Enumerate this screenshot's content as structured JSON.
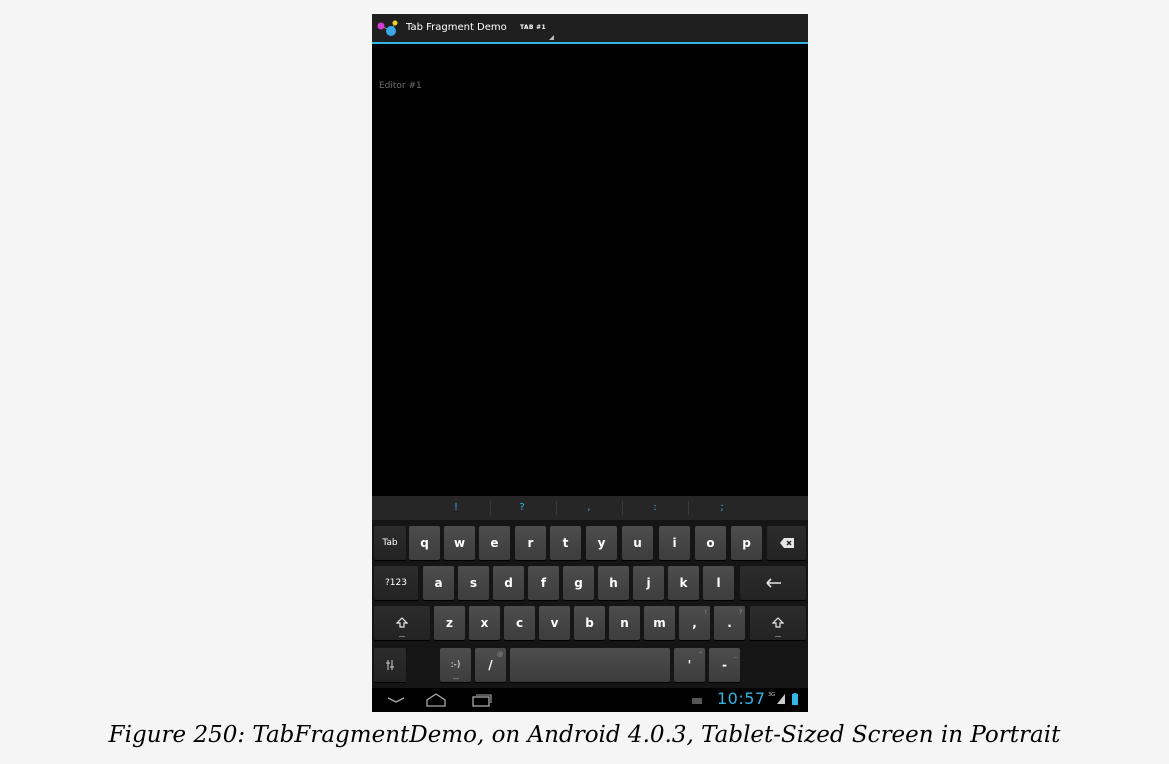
{
  "app": {
    "title": "Tab Fragment Demo",
    "tab_label": "TAB #1"
  },
  "editor": {
    "hint": "Editor #1"
  },
  "keyboard": {
    "suggestions": [
      "!",
      "?",
      ",",
      ":",
      ";"
    ],
    "row1": [
      "Tab",
      "q",
      "w",
      "e",
      "r",
      "t",
      "y",
      "u",
      "i",
      "o",
      "p"
    ],
    "row2": [
      "?123",
      "a",
      "s",
      "d",
      "f",
      "g",
      "h",
      "j",
      "k",
      "l"
    ],
    "row3": [
      "z",
      "x",
      "c",
      "v",
      "b",
      "n",
      "m",
      ",",
      "."
    ],
    "row3_alt": {
      "comma_alt": "!",
      "period_alt": "?"
    },
    "row4": {
      "smiley": ":-)",
      "slash": "/",
      "slash_alt": "@",
      "apostrophe": "'",
      "apostrophe_alt": "\"",
      "dash": "-",
      "dash_alt": "_"
    }
  },
  "status": {
    "clock": "10:57",
    "signal_label": "3G"
  },
  "caption": "Figure 250: TabFragmentDemo, on Android 4.0.3, Tablet-Sized Screen in Portrait",
  "colors": {
    "accent": "#33b5e5",
    "action_bar": "#1f1f1f",
    "background": "#000000",
    "key": "#444444"
  }
}
